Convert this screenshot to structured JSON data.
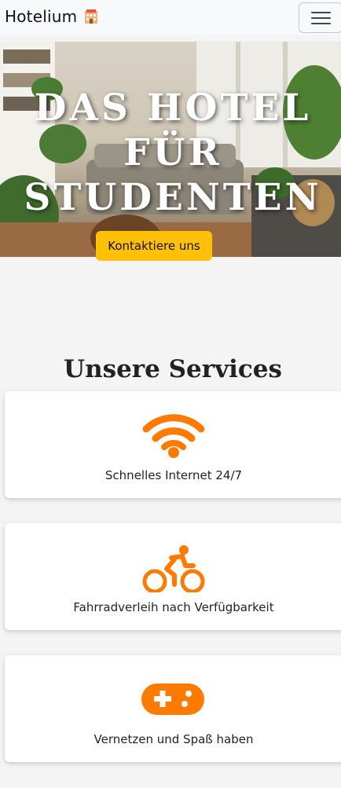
{
  "navbar": {
    "brand": "Hotelium",
    "brand_icon": "hotel-icon",
    "menu_icon": "hamburger-menu-icon"
  },
  "hero": {
    "title_lines": [
      "DAS HOTEL",
      "FÜR",
      "STUDENTEN"
    ],
    "cta_label": "Kontaktiere uns"
  },
  "services": {
    "title": "Unsere Services",
    "items": [
      {
        "icon": "wifi-icon",
        "label": "Schnelles Internet 24/7"
      },
      {
        "icon": "bicycle-icon",
        "label": "Fahrradverleih nach Verfügbarkeit"
      },
      {
        "icon": "gamepad-icon",
        "label": "Vernetzen und Spaß haben"
      }
    ]
  },
  "colors": {
    "accent": "#ff7a00",
    "button": "#ffc107",
    "navbar_bg": "#f8f9fa",
    "page_bg": "#f4f4f4"
  }
}
